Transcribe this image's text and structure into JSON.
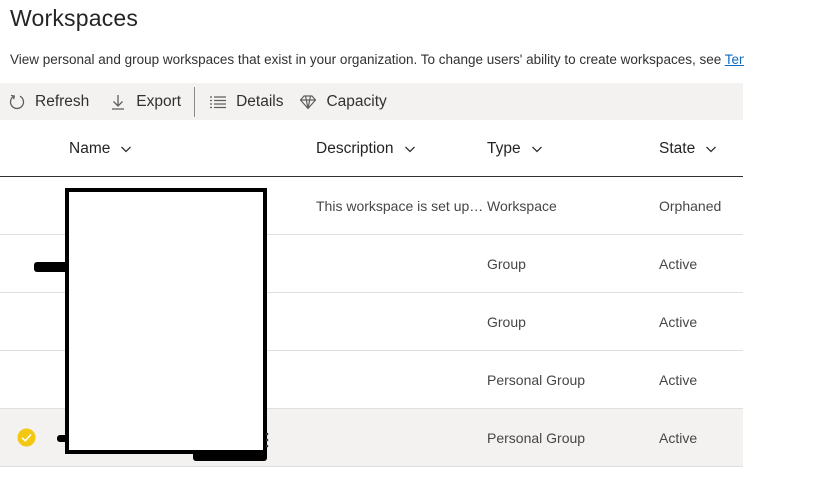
{
  "page": {
    "title": "Workspaces",
    "description_text": "View personal and group workspaces that exist in your organization. To change users' ability to create workspaces, see",
    "description_link": "Ten"
  },
  "toolbar": {
    "refresh_label": "Refresh",
    "export_label": "Export",
    "details_label": "Details",
    "capacity_label": "Capacity"
  },
  "grid": {
    "columns": {
      "name": "Name",
      "description": "Description",
      "type": "Type",
      "state": "State"
    },
    "rows": [
      {
        "description": "This workspace is set up s...",
        "type": "Workspace",
        "state": "Orphaned",
        "selected": false
      },
      {
        "description": "",
        "type": "Group",
        "state": "Active",
        "selected": false
      },
      {
        "description": "",
        "type": "Group",
        "state": "Active",
        "selected": false
      },
      {
        "description": "",
        "type": "Personal Group",
        "state": "Active",
        "selected": false
      },
      {
        "description": "",
        "type": "Personal Group",
        "state": "Active",
        "selected": true
      }
    ]
  },
  "colors": {
    "toolbar_bg": "#f3f2f1",
    "link": "#0f6cbd",
    "selected_check": "#f2c811"
  }
}
